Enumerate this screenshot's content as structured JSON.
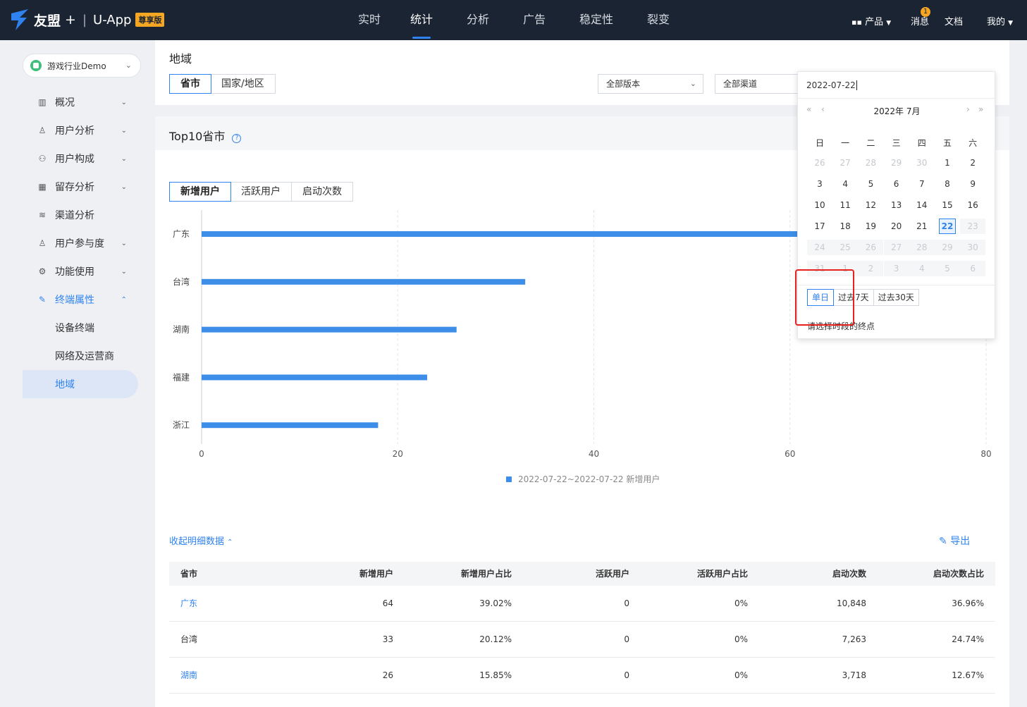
{
  "topbar": {
    "brand": "友盟",
    "plus": "+",
    "app": "U-App",
    "edition": "尊享版",
    "nav": [
      "实时",
      "统计",
      "分析",
      "广告",
      "稳定性",
      "裂变"
    ],
    "active_nav": "统计",
    "products": "产品",
    "messages": "消息",
    "message_count": "1",
    "docs": "文档",
    "mine": "我的"
  },
  "sidebar": {
    "app_name": "游戏行业Demo",
    "menu": [
      {
        "label": "概况",
        "icon": "bar-chart-icon"
      },
      {
        "label": "用户分析",
        "icon": "user-question-icon"
      },
      {
        "label": "用户构成",
        "icon": "user-badge-icon"
      },
      {
        "label": "留存分析",
        "icon": "calendar-grid-icon"
      },
      {
        "label": "渠道分析",
        "icon": "channel-icon"
      },
      {
        "label": "用户参与度",
        "icon": "user-engage-icon"
      },
      {
        "label": "功能使用",
        "icon": "gear-icon"
      },
      {
        "label": "终端属性",
        "icon": "device-edit-icon"
      }
    ],
    "submenu": [
      "设备终端",
      "网络及运营商",
      "地域"
    ],
    "active_sub": "地域"
  },
  "header": {
    "title": "地域",
    "tabs": [
      "省市",
      "国家/地区"
    ],
    "active_tab": "省市",
    "version_select": "全部版本",
    "channel_select": "全部渠道"
  },
  "calendar": {
    "input_value": "2022-07-22",
    "month_title": "2022年 7月",
    "weekdays": [
      "日",
      "一",
      "二",
      "三",
      "四",
      "五",
      "六"
    ],
    "rows": [
      [
        "26",
        "27",
        "28",
        "29",
        "30",
        "1",
        "2"
      ],
      [
        "3",
        "4",
        "5",
        "6",
        "7",
        "8",
        "9"
      ],
      [
        "10",
        "11",
        "12",
        "13",
        "14",
        "15",
        "16"
      ],
      [
        "17",
        "18",
        "19",
        "20",
        "21",
        "22",
        "23"
      ],
      [
        "24",
        "25",
        "26",
        "27",
        "28",
        "29",
        "30"
      ],
      [
        "31",
        "1",
        "2",
        "3",
        "4",
        "5",
        "6"
      ]
    ],
    "selected": "22",
    "quick": [
      "单日",
      "过去7天",
      "过去30天"
    ],
    "quick_active": "单日",
    "hint": "请选择时段的终点"
  },
  "chart_section": {
    "title": "Top10省市",
    "metric_tabs": [
      "新增用户",
      "活跃用户",
      "启动次数"
    ],
    "active_metric": "新增用户",
    "collapse_link": "收起明细数据",
    "export": "导出"
  },
  "chart_data": {
    "type": "bar",
    "orientation": "horizontal",
    "categories": [
      "广东",
      "台湾",
      "湖南",
      "福建",
      "浙江"
    ],
    "series": [
      {
        "name": "2022-07-22~2022-07-22 新增用户",
        "values": [
          64,
          33,
          26,
          23,
          18
        ]
      }
    ],
    "xlim": [
      0,
      80
    ],
    "xticks": [
      "0",
      "20",
      "40",
      "60",
      "80"
    ],
    "grid": true,
    "legend": "bottom",
    "color": "#3d8ee8"
  },
  "table": {
    "columns": [
      "省市",
      "新增用户",
      "新增用户占比",
      "活跃用户",
      "活跃用户占比",
      "启动次数",
      "启动次数占比"
    ],
    "rows": [
      [
        "广东",
        "64",
        "39.02%",
        "0",
        "0%",
        "10,848",
        "36.96%"
      ],
      [
        "台湾",
        "33",
        "20.12%",
        "0",
        "0%",
        "7,263",
        "24.74%"
      ],
      [
        "湖南",
        "26",
        "15.85%",
        "0",
        "0%",
        "3,718",
        "12.67%"
      ]
    ],
    "row_links": [
      true,
      false,
      true
    ]
  },
  "colors": {
    "accent": "#2f83f0",
    "topbar": "#1b2432",
    "highlight": "#e8211f"
  }
}
